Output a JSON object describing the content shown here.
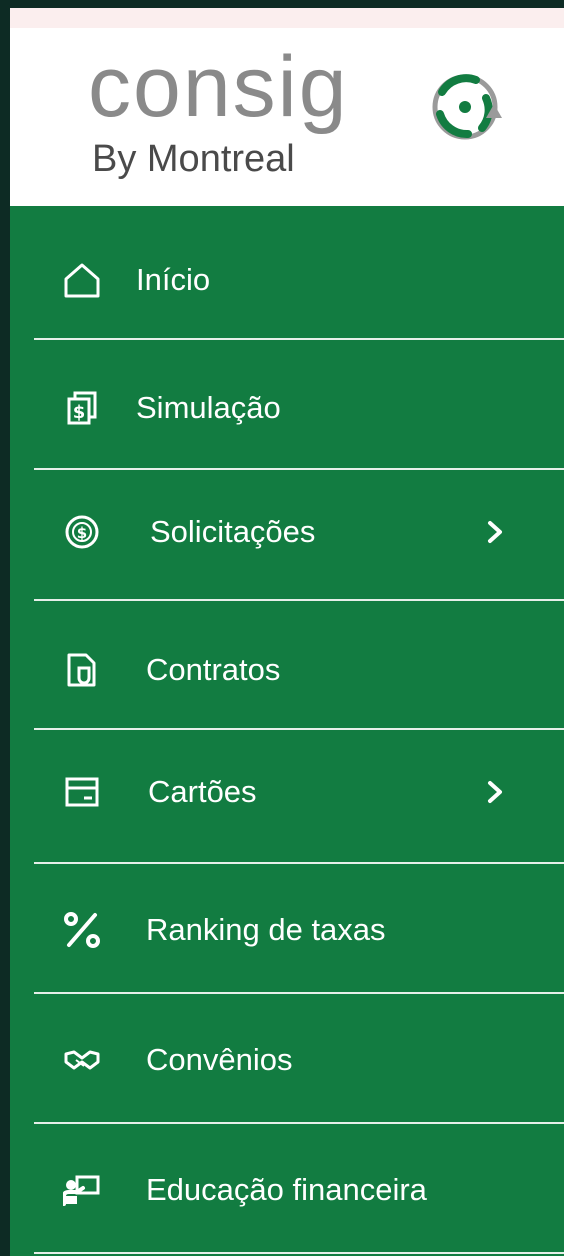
{
  "brand": {
    "name": "consig",
    "subtitle": "By Montreal",
    "logo_icon": "recycle-arrows-logo",
    "colors": {
      "green": "#127c41",
      "gray": "#8a8a8a",
      "dark": "#4a4a4a"
    }
  },
  "menu": {
    "items": [
      {
        "label": "Início",
        "icon": "home-icon",
        "has_submenu": false
      },
      {
        "label": "Simulação",
        "icon": "document-dollar-icon",
        "has_submenu": false
      },
      {
        "label": "Solicitações",
        "icon": "dollar-circle-icon",
        "has_submenu": true
      },
      {
        "label": "Contratos",
        "icon": "contract-icon",
        "has_submenu": false
      },
      {
        "label": "Cartões",
        "icon": "card-icon",
        "has_submenu": true
      },
      {
        "label": "Ranking de taxas",
        "icon": "percent-icon",
        "has_submenu": false
      },
      {
        "label": "Convênios",
        "icon": "handshake-icon",
        "has_submenu": false
      },
      {
        "label": "Educação financeira",
        "icon": "presentation-icon",
        "has_submenu": false
      }
    ]
  },
  "colors": {
    "menu_background": "#127c41",
    "divider": "#e6efe9",
    "page_border": "#0d2b24"
  }
}
